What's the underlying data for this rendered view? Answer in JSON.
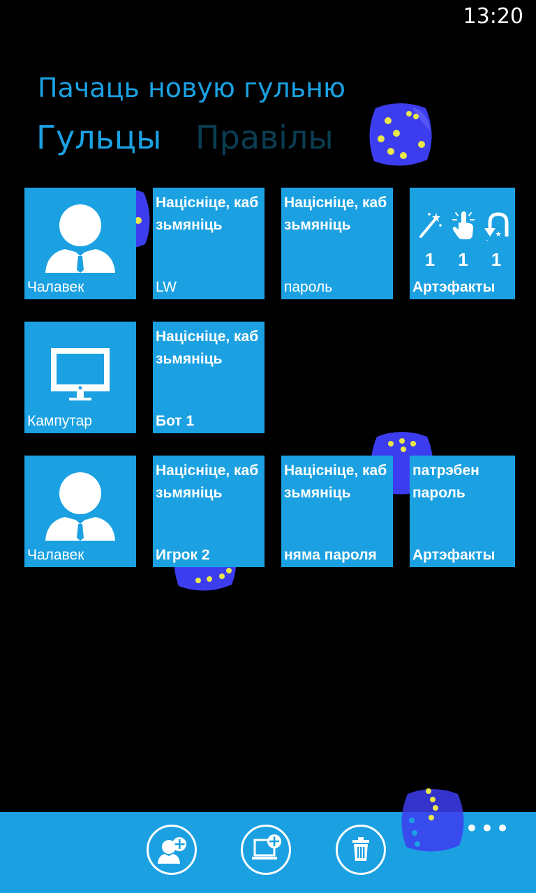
{
  "status_bar": {
    "time": "13:20"
  },
  "header": {
    "title": "Пачаць новую гульню",
    "tabs": [
      {
        "label": "Гульцы",
        "active": true
      },
      {
        "label": "Правілы",
        "active": false
      }
    ]
  },
  "players": [
    {
      "type_label": "Чалавек",
      "type_icon": "person-icon",
      "name_prompt": "Націсніце, каб зьмяніць",
      "name": "LW",
      "password_prompt": "Націсніце, каб зьмяніць",
      "password": "пароль",
      "artifacts": {
        "label": "Артэфакты",
        "counts": [
          "1",
          "1",
          "1"
        ],
        "icons": [
          "magic-wand-icon",
          "tap-icon",
          "undo-icon"
        ]
      }
    },
    {
      "type_label": "Кампутар",
      "type_icon": "monitor-icon",
      "name_prompt": "Націсніце, каб зьмяніць",
      "name": "Бот 1"
    },
    {
      "type_label": "Чалавек",
      "type_icon": "person-icon",
      "name_prompt": "Націсніце, каб зьмяніць",
      "name": "Игрок 2",
      "password_prompt": "Націсніце, каб зьмяніць",
      "password": "няма пароля",
      "artifacts": {
        "label": "Артэфакты",
        "note": "патрэбен пароль"
      }
    }
  ],
  "app_bar": {
    "buttons": [
      "add-human-player-icon",
      "add-computer-player-icon",
      "delete-icon"
    ],
    "more_label": "•••"
  },
  "colors": {
    "accent": "#1ba1e2",
    "background": "#000000",
    "inactive_tab": "#0b3d52",
    "dice": "#3d3df0",
    "pips": "#e8e84a"
  }
}
